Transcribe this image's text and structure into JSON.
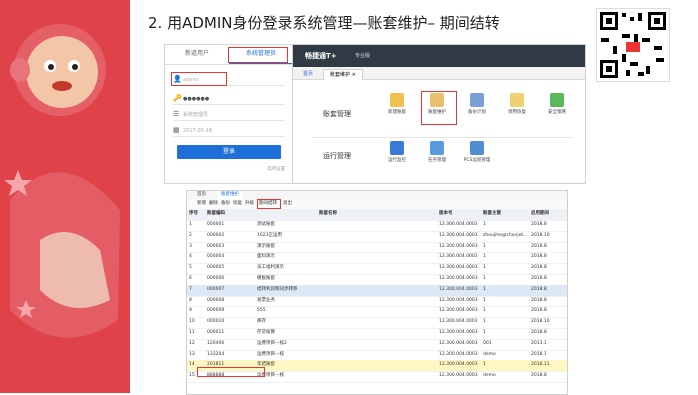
{
  "slide": {
    "title": "2. 用ADMIN身份登录系统管理—账套维护– 期间结转"
  },
  "colors": {
    "left_panel": "#e0424a",
    "accent_blue": "#1f6fd8",
    "highlight_red": "#e33333",
    "header_dark": "#2f3a44",
    "selected_row": "#fff7c2"
  },
  "login": {
    "tabs": [
      "新道用户",
      "系统管理员"
    ],
    "username": "admin",
    "password": "●●●●●●",
    "company": "系统管理员",
    "date": "2017-05-18",
    "button": "登录",
    "footer_link": "选项设置"
  },
  "app": {
    "title": "畅捷通T+",
    "edition": "专业版",
    "tabs": [
      "首页",
      "账套维护"
    ],
    "group1": {
      "label": "账套管理",
      "icons": [
        "新建账套",
        "账套维护",
        "备份计划",
        "领用恢复",
        "安全策略"
      ]
    },
    "group2": {
      "label": "运行管理",
      "icons": [
        "运行监控",
        "任务管理",
        "PCS远程管理"
      ]
    }
  },
  "table": {
    "tabs": [
      "首页",
      "账套维护"
    ],
    "toolbar": [
      "新增",
      "删除",
      "备份",
      "恢复",
      "升级",
      "期间结转",
      "退出"
    ],
    "columns": [
      "序号",
      "账套编码",
      "账套名称",
      "版本号",
      "账套主管",
      "启用期间"
    ],
    "rows": [
      [
        "1",
        "000001",
        "测试账套",
        "12.300.004.0003",
        "1",
        "2018.8"
      ],
      [
        "2",
        "000002",
        "1023正运用",
        "12.300.004.0003",
        "zhoujihe@chanjet...",
        "2018.10"
      ],
      [
        "3",
        "000003",
        "演示账套",
        "12.300.004.0003",
        "1",
        "2018.8"
      ],
      [
        "4",
        "000004",
        "面料演示",
        "12.300.004.0003",
        "1",
        "2018.8"
      ],
      [
        "5",
        "000005",
        "员工福利演示",
        "12.300.004.0003",
        "1",
        "2018.8"
      ],
      [
        "6",
        "000006",
        "模板账套",
        "12.300.004.0003",
        "1",
        "2018.8"
      ],
      [
        "7",
        "000007",
        "结转利润和同步转移",
        "12.300.004.0003",
        "1",
        "2018.8"
      ],
      [
        "8",
        "000008",
        "发票业务",
        "12.300.004.0003",
        "1",
        "2018.8"
      ],
      [
        "9",
        "000009",
        "555",
        "12.300.004.0003",
        "1",
        "2018.8"
      ],
      [
        "10",
        "000010",
        "库存",
        "12.300.004.0003",
        "1",
        "2018.10"
      ],
      [
        "11",
        "000011",
        "存货核算",
        "12.300.004.0003",
        "1",
        "2018.8"
      ],
      [
        "12",
        "120406",
        "运费项目—核2",
        "12.300.004.0003",
        "001",
        "2013.1"
      ],
      [
        "13",
        "133204",
        "运费项目—核",
        "12.300.004.0003",
        "demo",
        "2018.1"
      ],
      [
        "14",
        "201811",
        "年结账套",
        "12.300.004.0003",
        "1",
        "2018.11"
      ],
      [
        "15",
        "888888",
        "运费项目—核",
        "12.300.004.0003",
        "demo",
        "2018.8"
      ]
    ]
  }
}
